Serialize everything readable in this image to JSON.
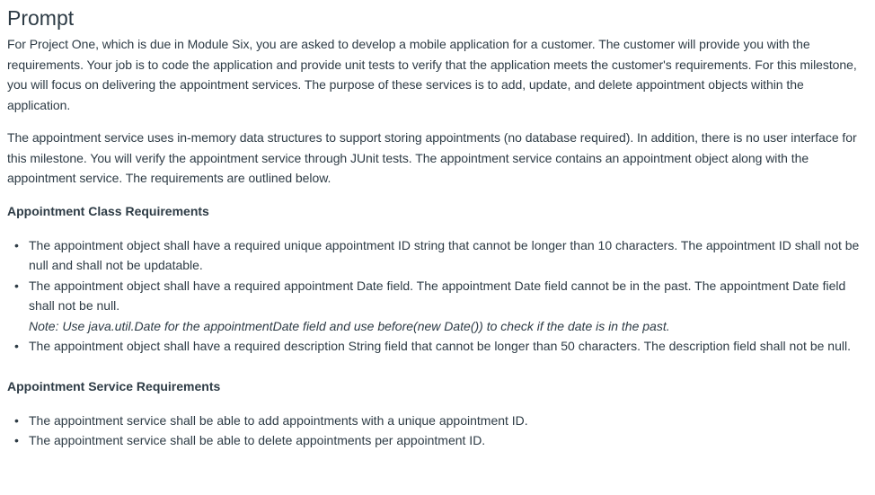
{
  "title": "Prompt",
  "paragraphs": [
    "For Project One, which is due in Module Six, you are asked to develop a mobile application for a customer. The customer will provide you with the requirements. Your job is to code the application and provide unit tests to verify that the application meets the customer's requirements. For this milestone, you will focus on delivering the appointment services. The purpose of these services is to add, update, and delete appointment objects within the application.",
    "The appointment service uses in-memory data structures to support storing appointments (no database required). In addition, there is no user interface for this milestone. You will verify the appointment service through JUnit tests. The appointment service contains an appointment object along with the appointment service. The requirements are outlined below."
  ],
  "sections": [
    {
      "heading": "Appointment Class Requirements",
      "items": [
        {
          "text": "The appointment object shall have a required unique appointment ID string that cannot be longer than 10 characters. The appointment ID shall not be null and shall not be updatable.",
          "note": ""
        },
        {
          "text": "The appointment object shall have a required appointment Date field. The appointment Date field cannot be in the past. The appointment Date field shall not be null.",
          "note": "Note: Use java.util.Date for the appointmentDate field and use before(new Date()) to check if the date is in the past."
        },
        {
          "text": "The appointment object shall have a required description String field that cannot be longer than 50 characters. The description field shall not be null.",
          "note": ""
        }
      ]
    },
    {
      "heading": "Appointment Service Requirements",
      "items": [
        {
          "text": "The appointment service shall be able to add appointments with a unique appointment ID.",
          "note": ""
        },
        {
          "text": "The appointment service shall be able to delete appointments per appointment ID.",
          "note": ""
        }
      ]
    }
  ]
}
